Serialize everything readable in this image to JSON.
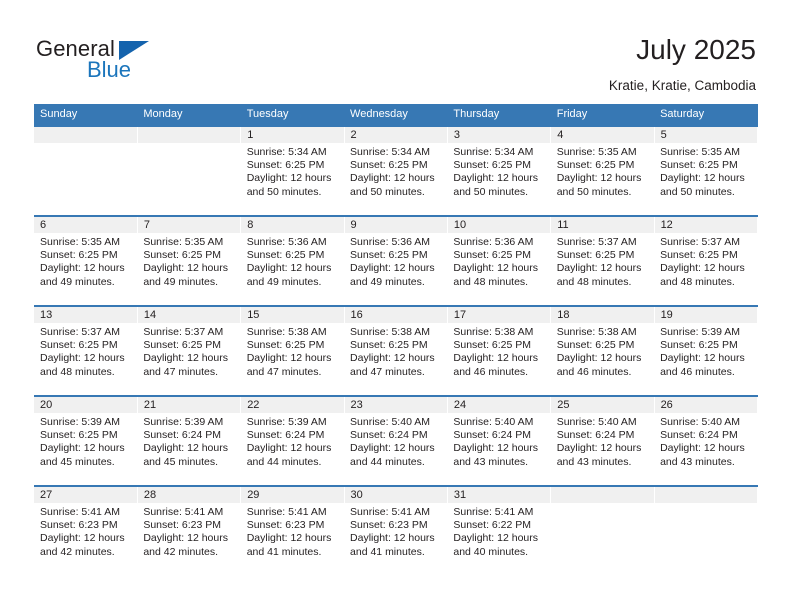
{
  "brand": {
    "name_top": "General",
    "name_bottom": "Blue",
    "triangle_color": "#1463ad",
    "blue_color": "#1b75bc"
  },
  "header": {
    "title": "July 2025",
    "location": "Kratie, Kratie, Cambodia"
  },
  "theme": {
    "header_blue": "#3778b4",
    "daynum_band": "#f0f0f0",
    "text": "#231f20"
  },
  "weekdays": [
    "Sunday",
    "Monday",
    "Tuesday",
    "Wednesday",
    "Thursday",
    "Friday",
    "Saturday"
  ],
  "labels": {
    "sunrise": "Sunrise:",
    "sunset": "Sunset:",
    "daylight": "Daylight:"
  },
  "weeks": [
    [
      {
        "day": "",
        "lines": []
      },
      {
        "day": "",
        "lines": []
      },
      {
        "day": "1",
        "lines": [
          "Sunrise: 5:34 AM",
          "Sunset: 6:25 PM",
          "Daylight: 12 hours",
          "and 50 minutes."
        ]
      },
      {
        "day": "2",
        "lines": [
          "Sunrise: 5:34 AM",
          "Sunset: 6:25 PM",
          "Daylight: 12 hours",
          "and 50 minutes."
        ]
      },
      {
        "day": "3",
        "lines": [
          "Sunrise: 5:34 AM",
          "Sunset: 6:25 PM",
          "Daylight: 12 hours",
          "and 50 minutes."
        ]
      },
      {
        "day": "4",
        "lines": [
          "Sunrise: 5:35 AM",
          "Sunset: 6:25 PM",
          "Daylight: 12 hours",
          "and 50 minutes."
        ]
      },
      {
        "day": "5",
        "lines": [
          "Sunrise: 5:35 AM",
          "Sunset: 6:25 PM",
          "Daylight: 12 hours",
          "and 50 minutes."
        ]
      }
    ],
    [
      {
        "day": "6",
        "lines": [
          "Sunrise: 5:35 AM",
          "Sunset: 6:25 PM",
          "Daylight: 12 hours",
          "and 49 minutes."
        ]
      },
      {
        "day": "7",
        "lines": [
          "Sunrise: 5:35 AM",
          "Sunset: 6:25 PM",
          "Daylight: 12 hours",
          "and 49 minutes."
        ]
      },
      {
        "day": "8",
        "lines": [
          "Sunrise: 5:36 AM",
          "Sunset: 6:25 PM",
          "Daylight: 12 hours",
          "and 49 minutes."
        ]
      },
      {
        "day": "9",
        "lines": [
          "Sunrise: 5:36 AM",
          "Sunset: 6:25 PM",
          "Daylight: 12 hours",
          "and 49 minutes."
        ]
      },
      {
        "day": "10",
        "lines": [
          "Sunrise: 5:36 AM",
          "Sunset: 6:25 PM",
          "Daylight: 12 hours",
          "and 48 minutes."
        ]
      },
      {
        "day": "11",
        "lines": [
          "Sunrise: 5:37 AM",
          "Sunset: 6:25 PM",
          "Daylight: 12 hours",
          "and 48 minutes."
        ]
      },
      {
        "day": "12",
        "lines": [
          "Sunrise: 5:37 AM",
          "Sunset: 6:25 PM",
          "Daylight: 12 hours",
          "and 48 minutes."
        ]
      }
    ],
    [
      {
        "day": "13",
        "lines": [
          "Sunrise: 5:37 AM",
          "Sunset: 6:25 PM",
          "Daylight: 12 hours",
          "and 48 minutes."
        ]
      },
      {
        "day": "14",
        "lines": [
          "Sunrise: 5:37 AM",
          "Sunset: 6:25 PM",
          "Daylight: 12 hours",
          "and 47 minutes."
        ]
      },
      {
        "day": "15",
        "lines": [
          "Sunrise: 5:38 AM",
          "Sunset: 6:25 PM",
          "Daylight: 12 hours",
          "and 47 minutes."
        ]
      },
      {
        "day": "16",
        "lines": [
          "Sunrise: 5:38 AM",
          "Sunset: 6:25 PM",
          "Daylight: 12 hours",
          "and 47 minutes."
        ]
      },
      {
        "day": "17",
        "lines": [
          "Sunrise: 5:38 AM",
          "Sunset: 6:25 PM",
          "Daylight: 12 hours",
          "and 46 minutes."
        ]
      },
      {
        "day": "18",
        "lines": [
          "Sunrise: 5:38 AM",
          "Sunset: 6:25 PM",
          "Daylight: 12 hours",
          "and 46 minutes."
        ]
      },
      {
        "day": "19",
        "lines": [
          "Sunrise: 5:39 AM",
          "Sunset: 6:25 PM",
          "Daylight: 12 hours",
          "and 46 minutes."
        ]
      }
    ],
    [
      {
        "day": "20",
        "lines": [
          "Sunrise: 5:39 AM",
          "Sunset: 6:25 PM",
          "Daylight: 12 hours",
          "and 45 minutes."
        ]
      },
      {
        "day": "21",
        "lines": [
          "Sunrise: 5:39 AM",
          "Sunset: 6:24 PM",
          "Daylight: 12 hours",
          "and 45 minutes."
        ]
      },
      {
        "day": "22",
        "lines": [
          "Sunrise: 5:39 AM",
          "Sunset: 6:24 PM",
          "Daylight: 12 hours",
          "and 44 minutes."
        ]
      },
      {
        "day": "23",
        "lines": [
          "Sunrise: 5:40 AM",
          "Sunset: 6:24 PM",
          "Daylight: 12 hours",
          "and 44 minutes."
        ]
      },
      {
        "day": "24",
        "lines": [
          "Sunrise: 5:40 AM",
          "Sunset: 6:24 PM",
          "Daylight: 12 hours",
          "and 43 minutes."
        ]
      },
      {
        "day": "25",
        "lines": [
          "Sunrise: 5:40 AM",
          "Sunset: 6:24 PM",
          "Daylight: 12 hours",
          "and 43 minutes."
        ]
      },
      {
        "day": "26",
        "lines": [
          "Sunrise: 5:40 AM",
          "Sunset: 6:24 PM",
          "Daylight: 12 hours",
          "and 43 minutes."
        ]
      }
    ],
    [
      {
        "day": "27",
        "lines": [
          "Sunrise: 5:41 AM",
          "Sunset: 6:23 PM",
          "Daylight: 12 hours",
          "and 42 minutes."
        ]
      },
      {
        "day": "28",
        "lines": [
          "Sunrise: 5:41 AM",
          "Sunset: 6:23 PM",
          "Daylight: 12 hours",
          "and 42 minutes."
        ]
      },
      {
        "day": "29",
        "lines": [
          "Sunrise: 5:41 AM",
          "Sunset: 6:23 PM",
          "Daylight: 12 hours",
          "and 41 minutes."
        ]
      },
      {
        "day": "30",
        "lines": [
          "Sunrise: 5:41 AM",
          "Sunset: 6:23 PM",
          "Daylight: 12 hours",
          "and 41 minutes."
        ]
      },
      {
        "day": "31",
        "lines": [
          "Sunrise: 5:41 AM",
          "Sunset: 6:22 PM",
          "Daylight: 12 hours",
          "and 40 minutes."
        ]
      },
      {
        "day": "",
        "lines": []
      },
      {
        "day": "",
        "lines": []
      }
    ]
  ]
}
